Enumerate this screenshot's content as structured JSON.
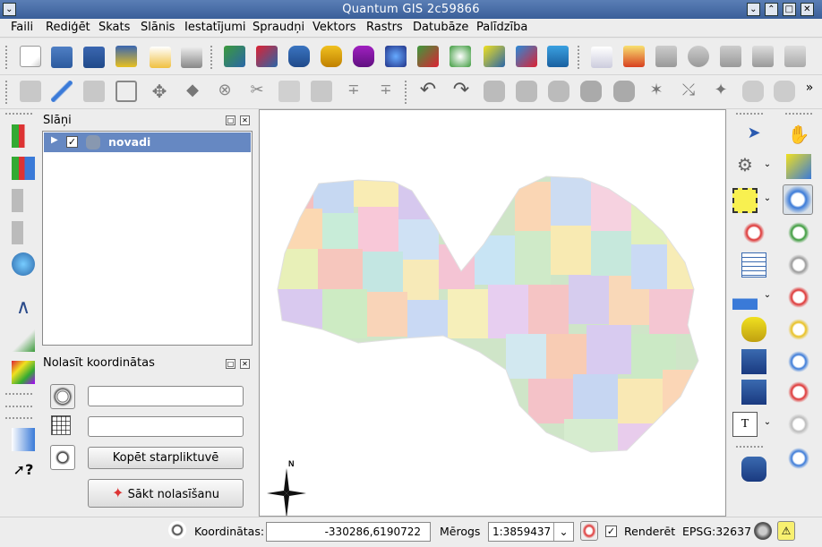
{
  "window": {
    "title": "Quantum GIS 2c59866"
  },
  "menu": [
    "Faili",
    "Rediģēt",
    "Skats",
    "Slānis",
    "Iestatījumi",
    "Spraudņi",
    "Vektors",
    "Rastrs",
    "Datubāze",
    "Palīdzība"
  ],
  "layers_panel": {
    "title": "Slāņi",
    "layer_name": "novadi"
  },
  "coord_panel": {
    "title": "Nolasīt koordinātas",
    "copy_button": "Kopēt starpliktuvē",
    "start_button": "Sākt nolasīšanu"
  },
  "map": {
    "north_label": "N"
  },
  "status": {
    "coords_label": "Koordinātas:",
    "coords_value": "-330286,6190722",
    "scale_label": "Mērogs",
    "scale_value": "1:3859437",
    "render_label": "Renderēt",
    "crs": "EPSG:32637"
  },
  "colors": {
    "selection": "#6688c2",
    "titlebar": "#4a6fa8"
  },
  "icons": {
    "toolbar1": [
      "new-project-icon",
      "open-project-icon",
      "save-project-icon",
      "save-as-icon",
      "print-composer-icon",
      "print-icon",
      "add-raster-icon",
      "add-wms-icon",
      "add-postgis-icon",
      "add-spatialite-icon",
      "add-mssql-icon",
      "add-wfs-icon",
      "add-vector-icon",
      "add-wcs-icon",
      "new-shapefile-icon",
      "remove-layer-icon",
      "add-csv-icon",
      "label-icon",
      "tip-icon",
      "highlight-icon",
      "show-icon",
      "plugin-icon",
      "plugin2-icon",
      "plugin3-icon"
    ]
  }
}
